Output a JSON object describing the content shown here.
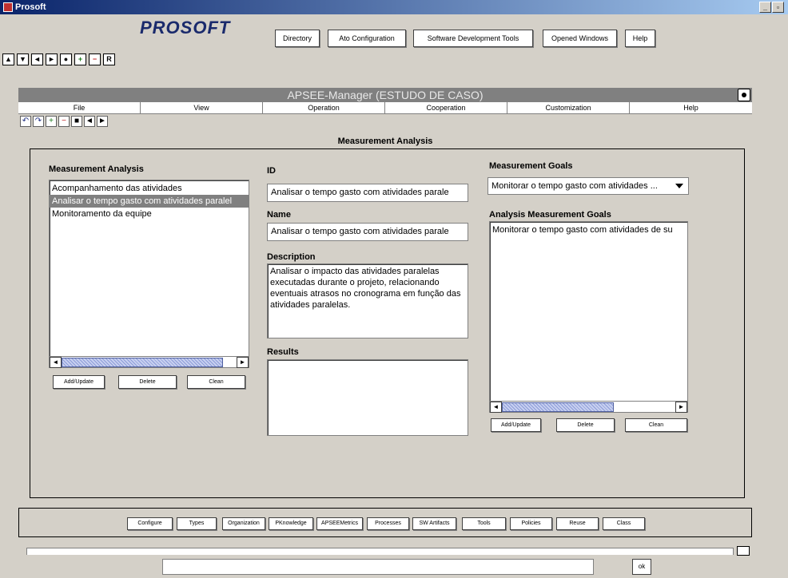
{
  "window": {
    "title": "Prosoft",
    "controls": [
      "_",
      "▫",
      "×"
    ]
  },
  "header": {
    "logo": "PROSOFT",
    "buttons": [
      "Directory",
      "Ato Configuration",
      "Software Development Tools",
      "Opened Windows",
      "Help"
    ]
  },
  "nav_icons": [
    "▲",
    "▼",
    "◄",
    "►",
    "●",
    "+",
    "−",
    "R"
  ],
  "internal_window": {
    "title": "APSEE-Manager (ESTUDO DE CASO)",
    "menu": [
      "File",
      "View",
      "Operation",
      "Cooperation",
      "Customization",
      "Help"
    ],
    "toolbar_icons": [
      "↶",
      "↷",
      "+",
      "−",
      "■",
      "◄",
      "►"
    ]
  },
  "measurement": {
    "section_title": "Measurement Analysis",
    "list_label": "Measurement Analysis",
    "list_items": [
      "Acompanhamento das atividades",
      "Analisar o tempo gasto com atividades paralel",
      "Monitoramento da equipe"
    ],
    "selected_index": 1,
    "list_buttons": {
      "add": "Add/Update",
      "delete": "Delete",
      "clean": "Clean"
    },
    "id_label": "ID",
    "id_value": "Analisar o tempo gasto com atividades parale",
    "name_label": "Name",
    "name_value": "Analisar o tempo gasto com atividades parale",
    "description_label": "Description",
    "description_value": "Analisar o impacto das atividades paralelas executadas durante o projeto, relacionando eventuais atrasos no cronograma em função das atividades paralelas.",
    "results_label": "Results",
    "results_value": "",
    "goals_label": "Measurement Goals",
    "goals_selected": "Monitorar o tempo gasto com atividades ...",
    "analysis_goals_label": "Analysis Measurement Goals",
    "analysis_goals_items": [
      "Monitorar o tempo gasto com atividades de su"
    ],
    "goals_buttons": {
      "add": "Add/Update",
      "delete": "Delete",
      "clean": "Clean"
    }
  },
  "bottom_buttons": [
    "Configure",
    "Types",
    "Organization",
    "PKnowledge",
    "APSEEMetrics",
    "Processes",
    "SW Artifacts",
    "Tools",
    "Policies",
    "Reuse",
    "Class"
  ],
  "footer": {
    "command_value": "",
    "ok_label": "ok"
  }
}
